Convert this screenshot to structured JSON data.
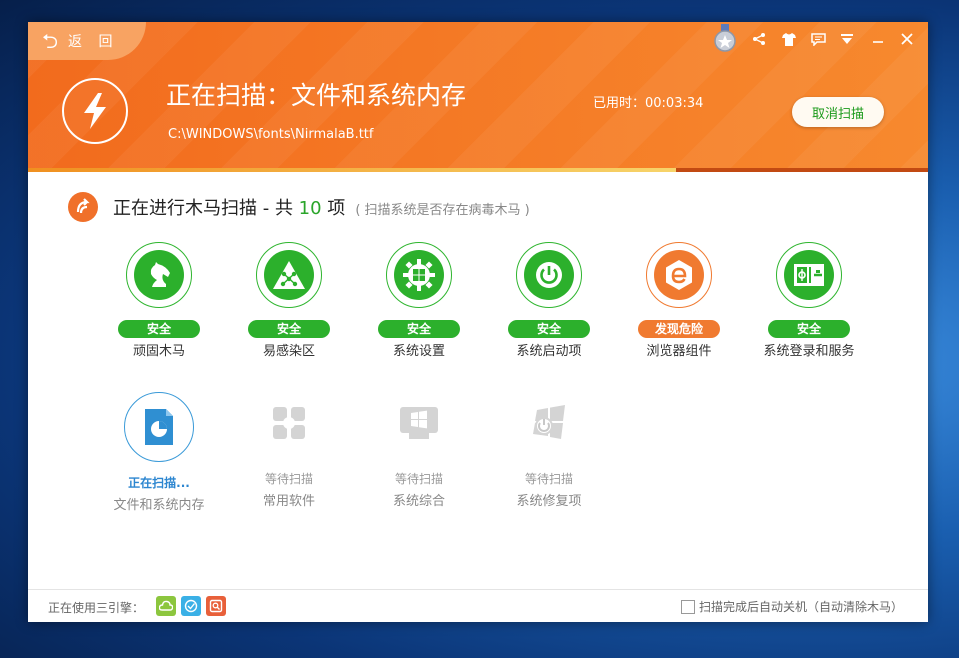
{
  "header": {
    "back_label": "返 回",
    "title": "正在扫描：文件和系统内存",
    "current_file": "C:\\WINDOWS\\fonts\\NirmalaB.ttf",
    "elapsed_label": "已用时：00:03:34",
    "cancel_label": "取消扫描",
    "progress": 0.72
  },
  "section": {
    "title_prefix": "正在进行木马扫描 - 共 ",
    "count": "10",
    "title_suffix": " 项",
    "note": "( 扫描系统是否存在病毒木马 )"
  },
  "items": [
    {
      "label": "顽固木马",
      "status": "安全",
      "icon": "horse-icon",
      "state": "safe"
    },
    {
      "label": "易感染区",
      "status": "安全",
      "icon": "network-triangle-icon",
      "state": "safe"
    },
    {
      "label": "系统设置",
      "status": "安全",
      "icon": "windows-gear-icon",
      "state": "safe"
    },
    {
      "label": "系统启动项",
      "status": "安全",
      "icon": "power-icon",
      "state": "safe"
    },
    {
      "label": "浏览器组件",
      "status": "发现危险",
      "icon": "browser-e-icon",
      "state": "danger"
    },
    {
      "label": "系统登录和服务",
      "status": "安全",
      "icon": "service-panel-icon",
      "state": "safe"
    },
    {
      "label": "文件和系统内存",
      "status": "正在扫描...",
      "icon": "file-chart-icon",
      "state": "scanning"
    },
    {
      "label": "常用软件",
      "status": "等待扫描",
      "icon": "apps-icon",
      "state": "pending"
    },
    {
      "label": "系统综合",
      "status": "等待扫描",
      "icon": "windows-box-icon",
      "state": "pending"
    },
    {
      "label": "系统修复项",
      "status": "等待扫描",
      "icon": "windows-repair-icon",
      "state": "pending"
    }
  ],
  "footer": {
    "engine_label": "正在使用三引擎：",
    "engines": [
      {
        "icon": "cloud-engine-icon",
        "color": "#8cc63e"
      },
      {
        "icon": "check-engine-icon",
        "color": "#3ab0e6"
      },
      {
        "icon": "search-engine-icon",
        "color": "#e8603a"
      }
    ],
    "auto_shutdown_label": "扫描完成后自动关机（自动清除木马）",
    "auto_shutdown_checked": false
  },
  "colors": {
    "header_orange": "#f26b1d",
    "safe_green": "#2cb02c",
    "danger_orange": "#f07a30",
    "active_blue": "#2c86d0"
  }
}
